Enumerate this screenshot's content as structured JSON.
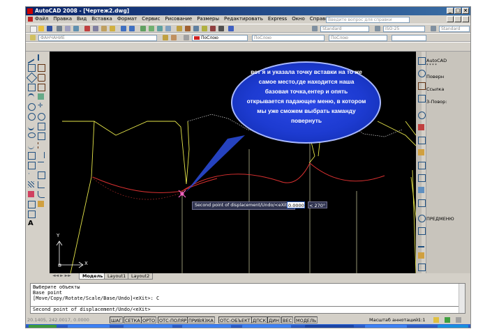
{
  "window": {
    "title": "AutoCAD 2008 - [Чертеж2.dwg]",
    "controls": [
      "_",
      "□",
      "×"
    ]
  },
  "menu": [
    "Файл",
    "Правка",
    "Вид",
    "Вставка",
    "Формат",
    "Сервис",
    "Рисование",
    "Размеры",
    "Редактировать",
    "Express",
    "Окно",
    "Справка"
  ],
  "help_search": {
    "placeholder": "Введите вопрос для справки"
  },
  "toolbar": {
    "layer_value": "ФАНЧАНИЕ",
    "textstyle_value": "Standard",
    "dimstyle_value": "ISO-25",
    "tablestyle_value": "Standard",
    "color_value": "ПоСлою",
    "linetype_value": "ПоСлою",
    "lineweight_value": "ПоСлою"
  },
  "annotation": {
    "text": "вот я и указала точку вставки на то же самое место,где находится наша базовая точка,ентер и опять открывается падающее меню, в котором мы уже сможем выбрать каманду повернуть"
  },
  "dynamic_input": {
    "prompt": "Second point of displacement/Undo/<eXit>:",
    "distance": "0.0000",
    "angle": "< 270°"
  },
  "ucs": {
    "x_label": "X",
    "y_label": "Y"
  },
  "layout_tabs": [
    "Модель",
    "Layout1",
    "Layout2"
  ],
  "right_palette": {
    "items": [
      "AutoCAD",
      "* * * *",
      "Поверн",
      "Ссылка",
      "3-Повор:"
    ],
    "bottom_item": "ПРЕДМЕНЮ"
  },
  "command_history": [
    "Выберите объекты",
    "Base point",
    "[Move/Copy/Rotate/Scale/Base/Undo]<eXit>: C"
  ],
  "command_line": "Second point of displacement/Undo/<eXit>",
  "status": {
    "coordinates": "20.1405, 242.0017, 0.0000",
    "modes": [
      "ШАГ",
      "СЕТКА",
      "ОРТО",
      "ОТС-ПОЛЯР",
      "ПРИВЯЗКА",
      "ОТС-ОБЪЕКТ",
      "ДПСК",
      "ДИН",
      "ВЕС",
      "МОДЕЛЬ"
    ],
    "scale_label": "Масштаб аннотаций:",
    "scale_value": "1:1"
  },
  "colors": {
    "title_bar": "#0a246a",
    "drawing_bg": "#000000",
    "line_yellow": "#e6e64a",
    "curve_red": "#d83030",
    "cursor_pink": "#ff66cc",
    "guide_grey": "#b8b890",
    "callout_blue": "#1d3bd1"
  }
}
